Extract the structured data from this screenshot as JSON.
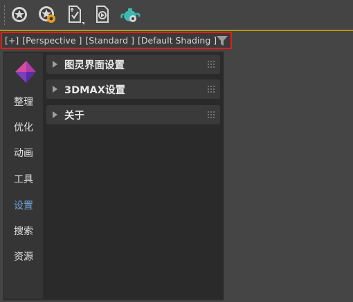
{
  "toolbar": {
    "buttons": [
      {
        "name": "star-gear-icon"
      },
      {
        "name": "settings-gear-icon"
      },
      {
        "name": "file-check-icon"
      },
      {
        "name": "file-export-icon"
      },
      {
        "name": "teapot-render-icon"
      }
    ]
  },
  "viewport_label": {
    "plus": "[+]",
    "view": "[Perspective ]",
    "mode": "[Standard ]",
    "shading": "[Default Shading ]"
  },
  "sidebar": {
    "items": [
      {
        "label": "整理"
      },
      {
        "label": "优化"
      },
      {
        "label": "动画"
      },
      {
        "label": "工具"
      },
      {
        "label": "设置",
        "active": true
      },
      {
        "label": "搜索"
      },
      {
        "label": "资源"
      }
    ]
  },
  "sections": [
    {
      "title": "图灵界面设置"
    },
    {
      "title": "3DMAX设置"
    },
    {
      "title": "关于"
    }
  ],
  "colors": {
    "accent_line": "#b8960c",
    "highlight_border": "#e0201c",
    "active_item": "#6fa4dc"
  }
}
